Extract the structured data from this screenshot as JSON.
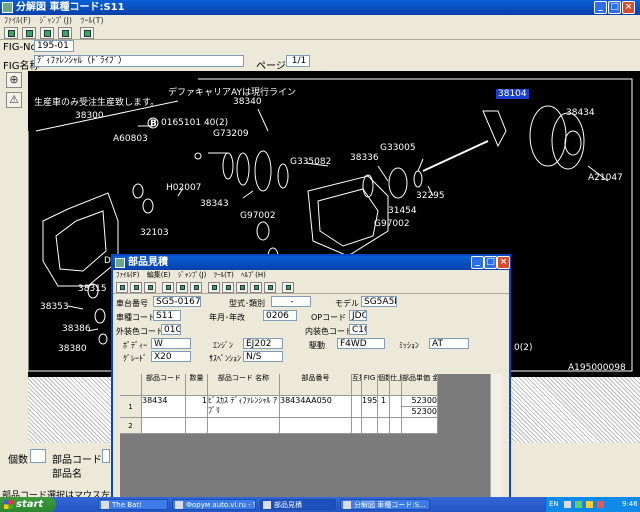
{
  "main_window": {
    "title": "分解図 車種コード:S11",
    "menu": [
      "ﾌｧｲﾙ(F)",
      "ｼﾞｬﾝﾌﾟ(J)",
      "ﾂｰﾙ(T)"
    ],
    "fig_no_label": "FIG-No",
    "fig_no_value": "195-01",
    "fig_name_label": "FIG名称",
    "fig_name_value": "ﾃﾞｨﾌｧﾚﾝｼｬﾙ（ﾄﾞﾗｲﾌﾞ）",
    "page_label": "ページ",
    "page_value": "1/1"
  },
  "diagram": {
    "note_line1": "デファキャリアAYは現行ライン",
    "note_line2": "生産車のみ受注生産致します。",
    "highlight_label": "38104",
    "footer_code": "A195000098",
    "partial_ring_label": "0(2)",
    "labels": [
      "38300",
      "A60803",
      "0165101 40(2)",
      "38340",
      "G73209",
      "G335082",
      "38336",
      "G33005",
      "38434",
      "A21047",
      "H02007",
      "38343",
      "G97002",
      "32295",
      "31454",
      "G97002",
      "32103",
      "38353",
      "38315",
      "38386",
      "38380",
      "D"
    ],
    "circle_mark": "B"
  },
  "bottom_panel": {
    "quantity_label": "個数",
    "part_code_label": "部品コード",
    "part_name_label": "部品名",
    "status_text": "部品コード選択はマウス左ボタン、選択"
  },
  "popup": {
    "title": "部品見積",
    "menu": [
      "ﾌｧｲﾙ(F)",
      "編集(E)",
      "ｼﾞｬﾝﾌﾟ(J)",
      "ﾂｰﾙ(T)",
      "ﾍﾙﾌﾟ(H)"
    ],
    "fields": {
      "vehicle_no_label": "車台番号",
      "vehicle_no": "SG5-01679!",
      "model_type_label": "型式･類別",
      "model_type": "-",
      "model_label": "モデル",
      "model": "SG5A5II",
      "car_code_label": "車種コード",
      "car_code": "S11",
      "year_label": "年月･年改",
      "year": "0206",
      "op_code_label": "OPコード",
      "op_code": "JDC",
      "ext_color_label": "外装色コード",
      "ext_color": "01G",
      "int_color_label": "内装色コード",
      "int_color": "C10",
      "body_label": "ﾎﾞﾃﾞｨｰ",
      "body": "W",
      "engine_label": "ｴﾝｼﾞﾝ",
      "engine": "EJ202",
      "drive_label": "駆動",
      "drive": "F4WD",
      "mission_label": "ﾐｯｼｮﾝ",
      "mission": "AT",
      "grade_label": "ｸﾞﾚｰﾄﾞ",
      "grade": "X20",
      "suspension_label": "ｻｽﾍﾟﾝｼｮﾝ",
      "suspension": "N/S"
    },
    "grid": {
      "headers": [
        "部品コード",
        "数量",
        "部品コード 名称",
        "部品番号",
        "互換",
        "FIG",
        "個数",
        "仕上",
        "部品単価 金額"
      ],
      "rows": [
        {
          "num": "1",
          "code": "38434",
          "qty": "1",
          "name": "ﾋﾞｽｶｽ ﾃﾞｨﾌｧﾚﾝｼｬﾙ ｱﾌﾞﾘ",
          "part_no": "38434AA050",
          "compat": "",
          "fig": "195",
          "count": "1",
          "finish": "",
          "price": "52300",
          "amount": "52300"
        },
        {
          "num": "2",
          "code": "",
          "qty": "",
          "name": "",
          "part_no": "",
          "compat": "",
          "fig": "",
          "count": "",
          "finish": "",
          "price": "",
          "amount": ""
        }
      ]
    }
  },
  "taskbar": {
    "start_label": "start",
    "tasks": [
      "The Bat!",
      "Форум auto.vl.ru - S...",
      "部品見積",
      "分解図 車種コード:S..."
    ],
    "lang": "EN",
    "clock": "9:46"
  },
  "colors": {
    "title_blue": "#0a5fd8",
    "highlight": "#1a3fd0",
    "diagram_bg": "#000000"
  }
}
